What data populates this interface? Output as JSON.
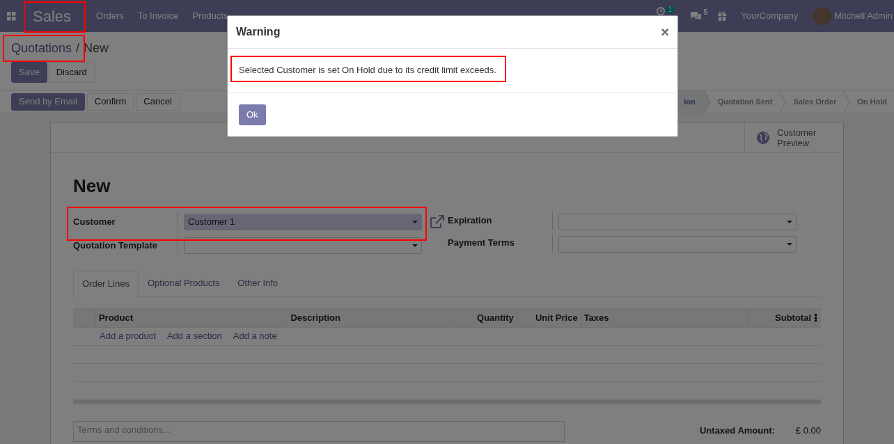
{
  "navbar": {
    "app_title": "Sales",
    "menu": [
      "Orders",
      "To Invoice",
      "Products"
    ],
    "activity_count": "1",
    "message_count": "5",
    "company": "YourCompany",
    "user": "Mitchell Admin"
  },
  "breadcrumb": [
    "Quotations",
    "New"
  ],
  "breadcrumb_separator": "/",
  "form_buttons": [
    {
      "label": "Save",
      "kind": "primary"
    },
    {
      "label": "Discard",
      "kind": "secondary"
    }
  ],
  "action_buttons": [
    {
      "label": "Send by Email",
      "kind": "primary"
    },
    {
      "label": "Confirm",
      "kind": "secondary"
    },
    {
      "label": "Cancel",
      "kind": "secondary"
    }
  ],
  "stages": [
    {
      "label": "ion",
      "selected": true
    },
    {
      "label": "Quotation Sent",
      "selected": false
    },
    {
      "label": "Sales Order",
      "selected": false
    },
    {
      "label": "On Hold",
      "selected": false
    }
  ],
  "smart_button": {
    "label": "Customer Preview"
  },
  "title": "New",
  "fields_left": [
    {
      "label": "Customer",
      "value": "Customer 1",
      "highlighted": true
    },
    {
      "label": "Quotation Template",
      "highlighted": false
    }
  ],
  "fields_right": [
    {
      "label": "Expiration"
    },
    {
      "label": "Payment Terms"
    }
  ],
  "tabs": [
    {
      "label": "Order Lines",
      "selected": true
    },
    {
      "label": "Optional Products",
      "selected": false
    },
    {
      "label": "Other Info",
      "selected": false
    }
  ],
  "table": {
    "columns": [
      "Product",
      "Description",
      "Quantity",
      "Unit Price",
      "Taxes",
      "Subtotal"
    ],
    "add_links": [
      "Add a product",
      "Add a section",
      "Add a note"
    ]
  },
  "terms": {
    "placeholder": "Terms and conditions..."
  },
  "totals": [
    {
      "label": "Untaxed Amount:",
      "value": "£ 0.00"
    }
  ],
  "modal": {
    "title": "Warning",
    "close": "×",
    "message": "Selected Customer is set On Hold due to its credit limit exceeds.",
    "button": "Ok"
  }
}
